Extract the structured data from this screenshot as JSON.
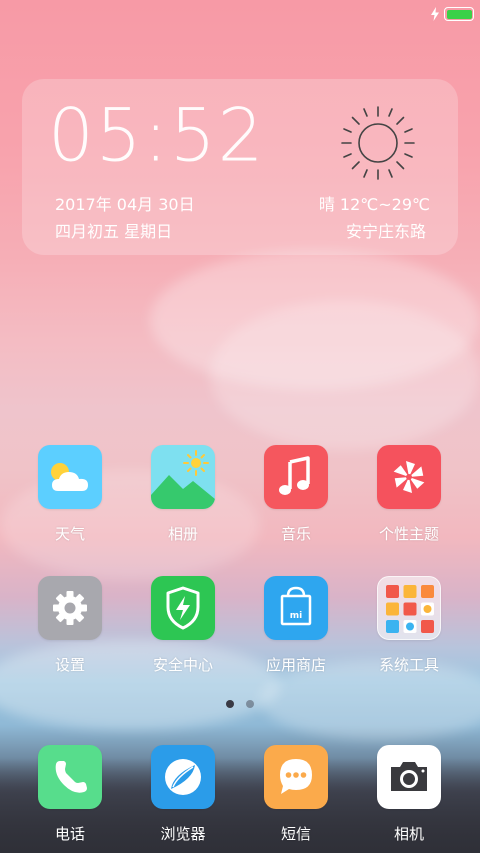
{
  "status": {
    "battery_level": 1.0,
    "charging": true
  },
  "widget": {
    "time": "05:52",
    "date": "2017年 04月 30日",
    "lunar_weekday": "四月初五  星期日",
    "weather": "晴  12℃~29℃",
    "location": "安宁庄东路"
  },
  "apps": [
    {
      "label": "天气",
      "icon": "weather-icon"
    },
    {
      "label": "相册",
      "icon": "gallery-icon"
    },
    {
      "label": "音乐",
      "icon": "music-icon"
    },
    {
      "label": "个性主题",
      "icon": "themes-icon"
    },
    {
      "label": "设置",
      "icon": "settings-icon"
    },
    {
      "label": "安全中心",
      "icon": "security-icon"
    },
    {
      "label": "应用商店",
      "icon": "app-store-icon"
    },
    {
      "label": "系统工具",
      "icon": "folder-icon"
    }
  ],
  "pager": {
    "pages": 2,
    "current": 1
  },
  "dock": [
    {
      "label": "电话",
      "icon": "phone-icon"
    },
    {
      "label": "浏览器",
      "icon": "browser-icon"
    },
    {
      "label": "短信",
      "icon": "messages-icon"
    },
    {
      "label": "相机",
      "icon": "camera-icon"
    }
  ],
  "colors": {
    "weather": "#5ccfff",
    "gallery": "#7ee0f0",
    "music": "#f5575e",
    "themes": "#f5525d",
    "settings": "#a8a8ae",
    "security": "#2dc653",
    "app_store": "#2ea6ef",
    "phone": "#57dd8c",
    "browser": "#2b9ce9",
    "messages": "#fbaa4b",
    "camera": "#ffffff",
    "battery": "#3bd148"
  }
}
